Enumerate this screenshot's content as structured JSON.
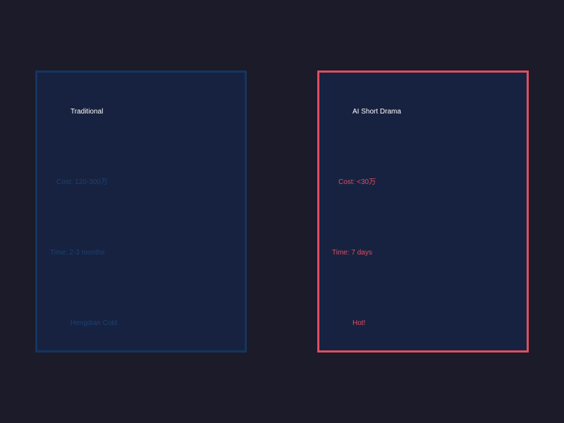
{
  "colors": {
    "background": "#1b1b2a",
    "panel_fill": "#172240",
    "traditional_accent": "#143560",
    "traditional_text": "#1d4070",
    "ai_accent": "#e04e60",
    "title_text": "#ffffff"
  },
  "traditional": {
    "title": "Traditional",
    "cost": "Cost: 120-300万",
    "time": "Time: 2-3 months",
    "status": "Hengdian Cold"
  },
  "ai_drama": {
    "title": "AI Short Drama",
    "cost": "Cost: <30万",
    "time": "Time: 7 days",
    "status": "Hot!"
  }
}
